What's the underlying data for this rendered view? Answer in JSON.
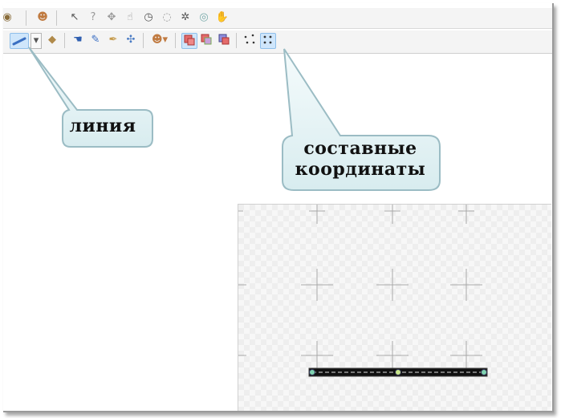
{
  "callouts": {
    "line_label": "линия",
    "composite_label": "составные координаты"
  },
  "colors": {
    "selected_tool_bg": "#cfe6fb",
    "callout_fill": "#e8f4f6",
    "callout_stroke": "#9bbcc4",
    "segment": "#111111",
    "point": "#7fd3b0"
  },
  "toolbar_top": {
    "icons": [
      "globe-icon",
      "user-icon",
      "arrow-cursor-icon",
      "help-question-icon",
      "move-cross-icon",
      "hand-pointer-icon",
      "clock-dial-icon",
      "dotted-circle-icon",
      "gear-ring-icon",
      "ring-icon",
      "hand-fire-icon"
    ]
  },
  "toolbar_bottom": {
    "icons": [
      "line-tool-icon",
      "dropdown-arrow-icon",
      "paint-bucket-icon",
      "blue-hand-icon",
      "brush-icon",
      "pipette-icon",
      "move-arrows-icon",
      "user-dropdown-icon",
      "overlap-a-icon",
      "overlap-b-icon",
      "overlap-c-icon",
      "scatter-points-icon",
      "composite-coords-icon"
    ]
  }
}
